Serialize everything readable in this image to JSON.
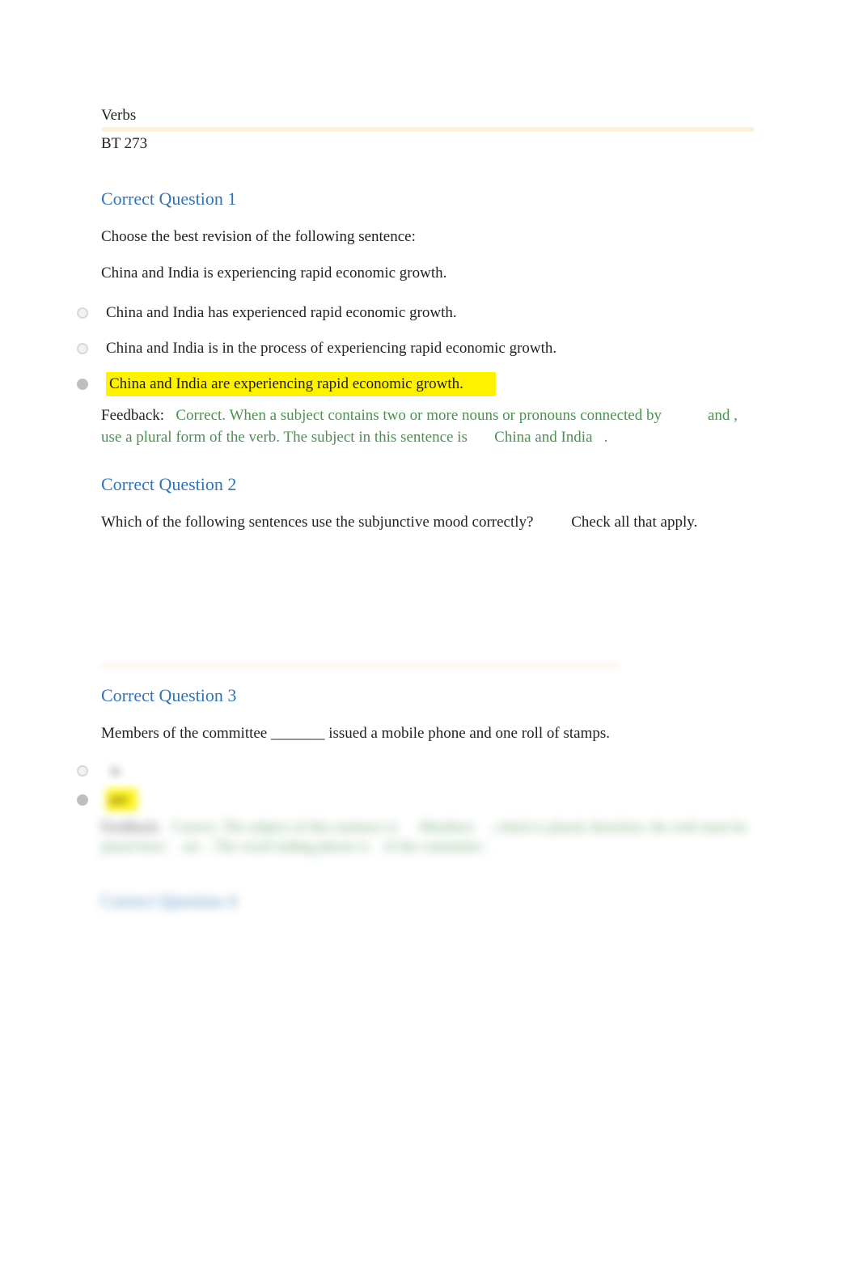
{
  "header": {
    "line1": "Verbs",
    "line2": "BT 273"
  },
  "q1": {
    "title": "Correct Question 1",
    "stem": "Choose the best revision of the following sentence:",
    "sentence": "China and India is experiencing rapid economic growth.",
    "options": {
      "a": "China and India has experienced rapid economic growth.",
      "b": "China and India is in the process of experiencing rapid economic growth.",
      "c": "China and India are experiencing rapid economic growth."
    },
    "feedback": {
      "label": "Feedback:",
      "part1": "Correct. When a subject contains two or more nouns or pronouns connected by",
      "and": "and",
      "part2": ", use a plural form of the verb. The subject in this sentence is",
      "subject": "China and India",
      "period": "."
    }
  },
  "q2": {
    "title": "Correct Question 2",
    "prompt": "Which of the following sentences use the subjunctive mood correctly?",
    "check_all": "Check all that apply."
  },
  "q3": {
    "title": "Correct Question 3",
    "prompt": "Members of the committee _______ issued a mobile phone and one roll of stamps.",
    "options": {
      "a": "is",
      "b": "are"
    },
    "feedback": {
      "label": "Feedback:",
      "part1": "Correct. The subject of this sentence is",
      "subj": "Members",
      "part2": ", which is plural; therefore, the verb must be plural here:",
      "are": "are",
      "part3": ". The word ending phrase is",
      "phrase": "of the committee",
      "period": "."
    }
  },
  "q4": {
    "title": "Correct Question 4"
  }
}
